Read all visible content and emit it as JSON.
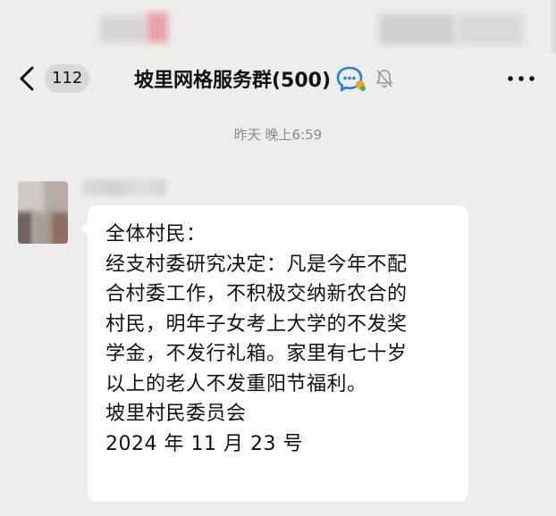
{
  "header": {
    "back_count": "112",
    "title": "坡里网格服务群(500)"
  },
  "timestamp": "昨天 晚上6:59",
  "message": {
    "lines": [
      "全体村民：",
      "经支村委研究决定：凡是今年不配",
      "合村委工作，不积极交纳新农合的",
      "村民，明年子女考上大学的不发奖",
      "学金，不发行礼箱。家里有七十岁",
      "以上的老人不发重阳节福利。",
      "坡里村民委员会",
      "2024 年 11 月 23 号"
    ]
  },
  "icons": {
    "back": "chevron-left-icon",
    "group": "group-chat-icon",
    "mute": "bell-off-icon",
    "more": "more-dots-icon"
  },
  "colors": {
    "background": "#ededed",
    "bubble": "#ffffff",
    "badge": "#d8d8d8",
    "group_icon_blue": "#1e7ff0",
    "group_icon_orange": "#f5a623",
    "group_icon_green": "#2fbf4a"
  }
}
